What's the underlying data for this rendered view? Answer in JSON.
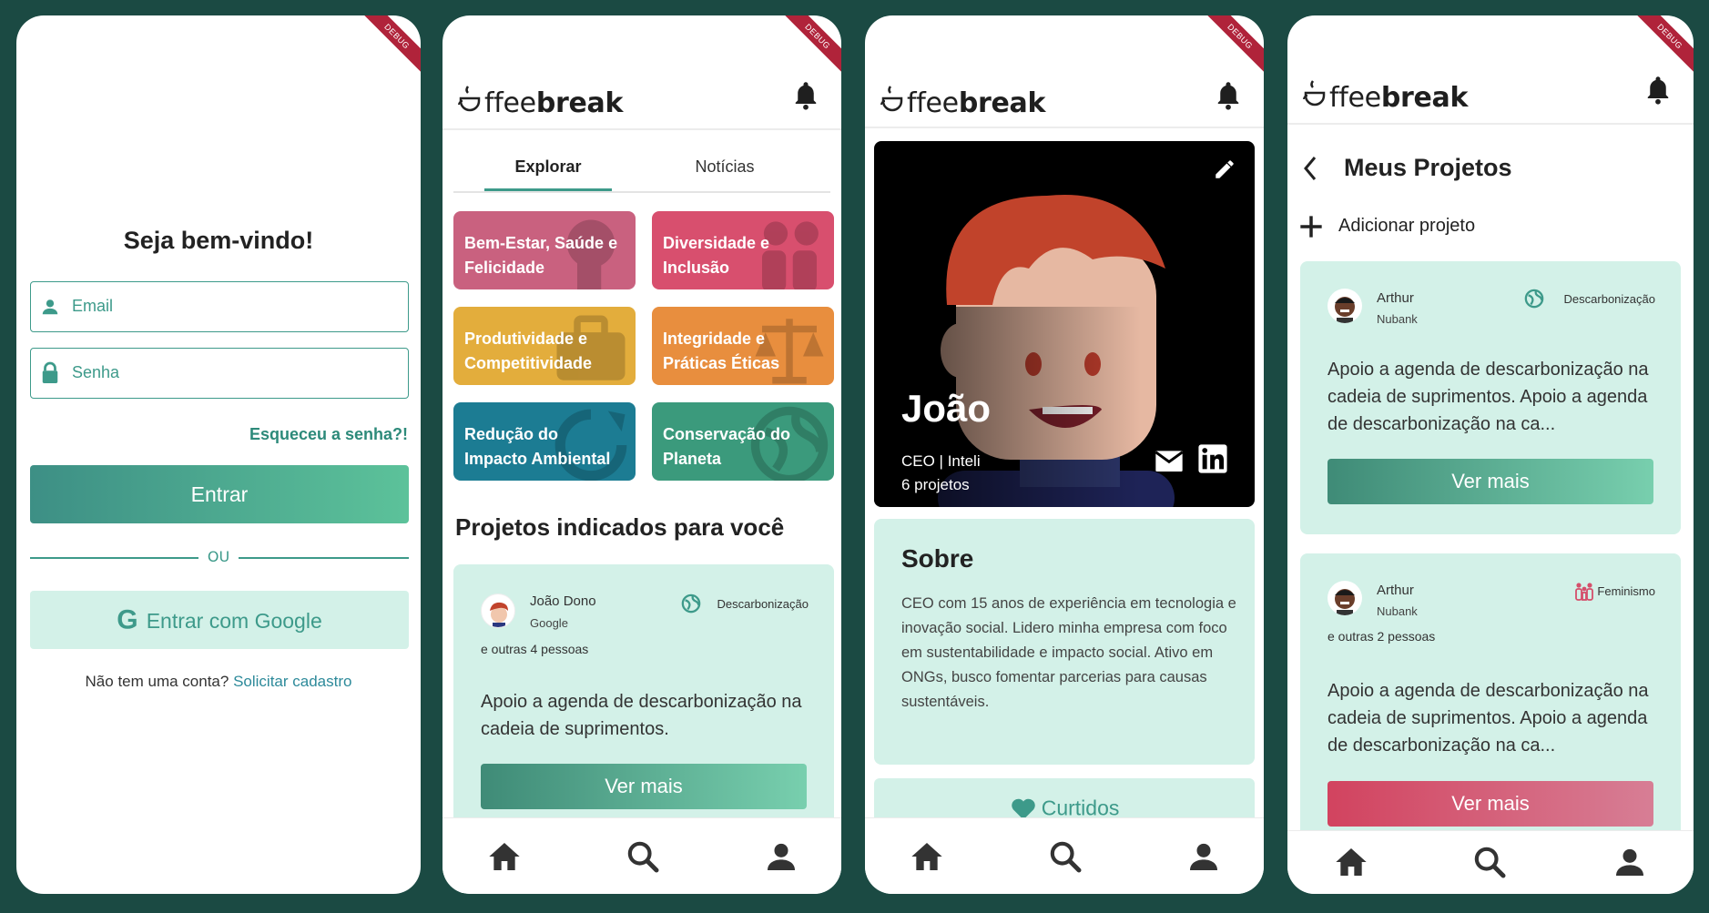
{
  "debug_label": "DEBUG",
  "login": {
    "title": "Seja bem-vindo!",
    "email_placeholder": "Email",
    "password_placeholder": "Senha",
    "forgot": "Esqueceu a senha?!",
    "enter": "Entrar",
    "or": "OU",
    "google": "Entrar com Google",
    "no_account": "Não tem uma conta?",
    "request": "Solicitar cadastro"
  },
  "brand": {
    "part1": "ffee",
    "part2": "break"
  },
  "explore": {
    "tabs": [
      "Explorar",
      "Notícias"
    ],
    "categories": [
      {
        "label": "Bem-Estar, Saúde e Felicidade",
        "color": "#c9617f"
      },
      {
        "label": "Diversidade e Inclusão",
        "color": "#d84f6e"
      },
      {
        "label": "Produtividade e Competitividade",
        "color": "#e3ad3c"
      },
      {
        "label": "Integridade e Práticas Éticas",
        "color": "#e88e3e"
      },
      {
        "label": "Redução do Impacto Ambiental",
        "color": "#1c7c93"
      },
      {
        "label": "Conservação do Planeta",
        "color": "#3b9a7c"
      }
    ],
    "section_title": "Projetos indicados para você",
    "project": {
      "author": "João Dono",
      "company": "Google",
      "tag": "Descarbonização",
      "others": "e outras 4 pessoas",
      "description": "Apoio a agenda de descarbonização na cadeia de suprimentos.",
      "cta": "Ver mais"
    }
  },
  "profile": {
    "name": "João",
    "role": "CEO | Inteli",
    "projects": "6 projetos",
    "about_title": "Sobre",
    "about_text": "CEO com 15 anos de experiência em tecnologia e inovação social. Lidero minha empresa com foco em sustentabilidade e impacto social. Ativo em ONGs, busco fomentar parcerias para causas sustentáveis.",
    "liked": "Curtidos"
  },
  "my_projects": {
    "title": "Meus Projetos",
    "add": "Adicionar projeto",
    "items": [
      {
        "author": "Arthur",
        "company": "Nubank",
        "tag": "Descarbonização",
        "others": "",
        "description": "Apoio a agenda de descarbonização na cadeia de suprimentos. Apoio a agenda de descarbonização na ca...",
        "cta": "Ver mais"
      },
      {
        "author": "Arthur",
        "company": "Nubank",
        "tag": "Feminismo",
        "others": "e outras 2 pessoas",
        "description": "Apoio a agenda de descarbonização na cadeia de suprimentos. Apoio a agenda de descarbonização na ca...",
        "cta": "Ver mais"
      }
    ]
  },
  "colors": {
    "primary": "#3d9a8a",
    "mint": "#d3f1e8",
    "pink": "#d54f6b",
    "background": "#1b4a43"
  }
}
